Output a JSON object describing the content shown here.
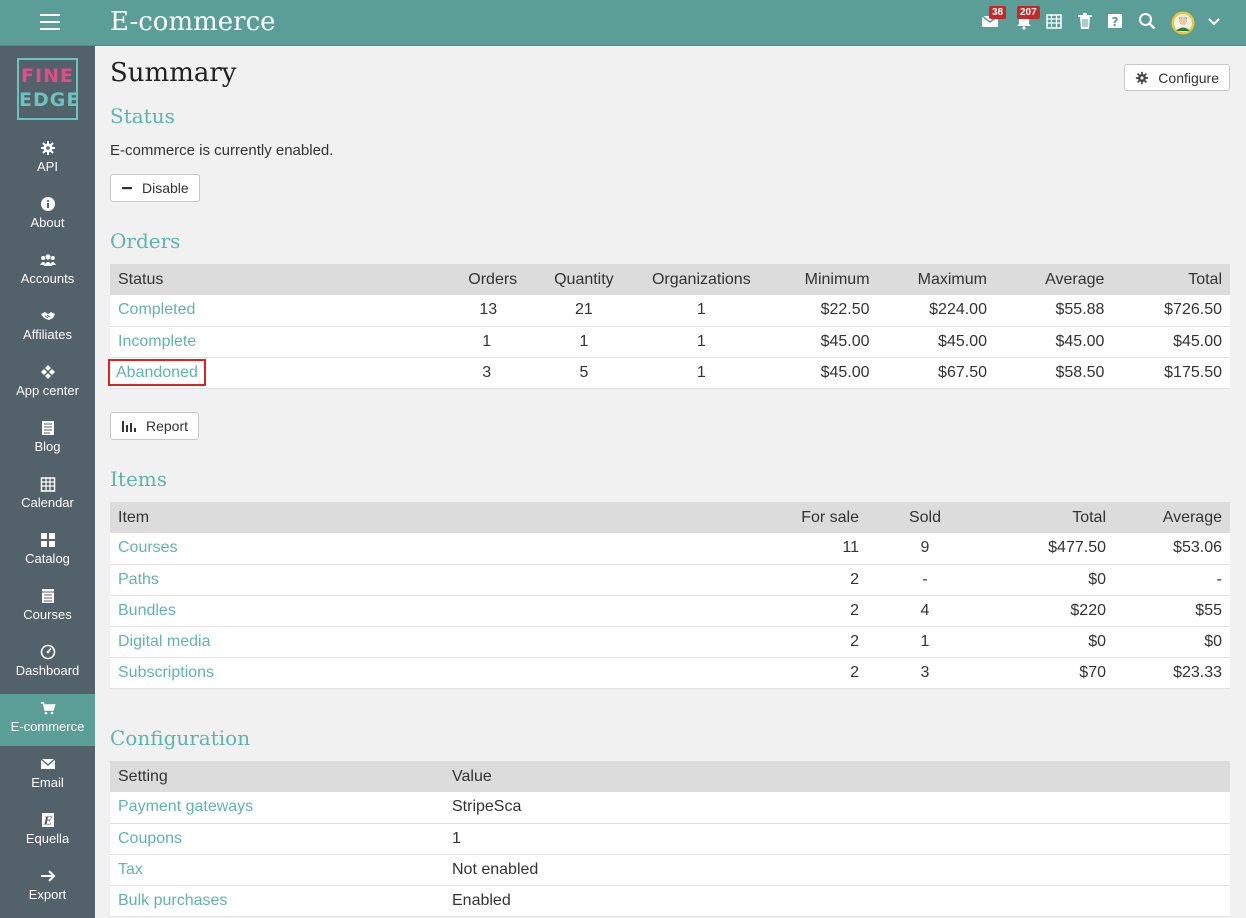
{
  "header": {
    "title": "E-commerce",
    "mail_badge": "38",
    "notifications_badge": "207",
    "colors": {
      "bar": "#5a9e97",
      "badge": "#c62828"
    },
    "icons": [
      "menu-icon",
      "mail-icon",
      "bell-icon",
      "calendar-icon",
      "trash-icon",
      "help-icon",
      "search-icon",
      "avatar",
      "chevron-down-icon"
    ]
  },
  "logo": {
    "line1": "FINE",
    "line2": "EDGE"
  },
  "sidebar": {
    "items": [
      {
        "label": "API",
        "icon": "gear-icon"
      },
      {
        "label": "About",
        "icon": "info-icon"
      },
      {
        "label": "Accounts",
        "icon": "users-icon"
      },
      {
        "label": "Affiliates",
        "icon": "handshake-icon"
      },
      {
        "label": "App center",
        "icon": "apps-icon"
      },
      {
        "label": "Blog",
        "icon": "blog-icon"
      },
      {
        "label": "Calendar",
        "icon": "calendar-icon"
      },
      {
        "label": "Catalog",
        "icon": "grid-icon"
      },
      {
        "label": "Courses",
        "icon": "courses-icon"
      },
      {
        "label": "Dashboard",
        "icon": "dashboard-icon"
      },
      {
        "label": "E-commerce",
        "icon": "cart-icon"
      },
      {
        "label": "Email",
        "icon": "envelope-icon"
      },
      {
        "label": "Equella",
        "icon": "equella-icon"
      },
      {
        "label": "Export",
        "icon": "arrow-right-icon"
      }
    ]
  },
  "page": {
    "title": "Summary",
    "configure_label": "Configure"
  },
  "status": {
    "heading": "Status",
    "text": "E-commerce is currently enabled.",
    "disable_label": "Disable"
  },
  "orders": {
    "heading": "Orders",
    "columns": [
      "Status",
      "Orders",
      "Quantity",
      "Organizations",
      "Minimum",
      "Maximum",
      "Average",
      "Total"
    ],
    "rows": [
      [
        "Completed",
        "13",
        "21",
        "1",
        "$22.50",
        "$224.00",
        "$55.88",
        "$726.50"
      ],
      [
        "Incomplete",
        "1",
        "1",
        "1",
        "$45.00",
        "$45.00",
        "$45.00",
        "$45.00"
      ],
      [
        "Abandoned",
        "3",
        "5",
        "1",
        "$45.00",
        "$67.50",
        "$58.50",
        "$175.50"
      ]
    ],
    "report_label": "Report"
  },
  "items": {
    "heading": "Items",
    "columns": [
      "Item",
      "For sale",
      "Sold",
      "Total",
      "Average"
    ],
    "rows": [
      [
        "Courses",
        "11",
        "9",
        "$477.50",
        "$53.06"
      ],
      [
        "Paths",
        "2",
        "-",
        "$0",
        "-"
      ],
      [
        "Bundles",
        "2",
        "4",
        "$220",
        "$55"
      ],
      [
        "Digital media",
        "2",
        "1",
        "$0",
        "$0"
      ],
      [
        "Subscriptions",
        "2",
        "3",
        "$70",
        "$23.33"
      ]
    ]
  },
  "configuration": {
    "heading": "Configuration",
    "columns": [
      "Setting",
      "Value"
    ],
    "rows": [
      [
        "Payment gateways",
        "StripeSca"
      ],
      [
        "Coupons",
        "1"
      ],
      [
        "Tax",
        "Not enabled"
      ],
      [
        "Bulk purchases",
        "Enabled"
      ]
    ]
  }
}
